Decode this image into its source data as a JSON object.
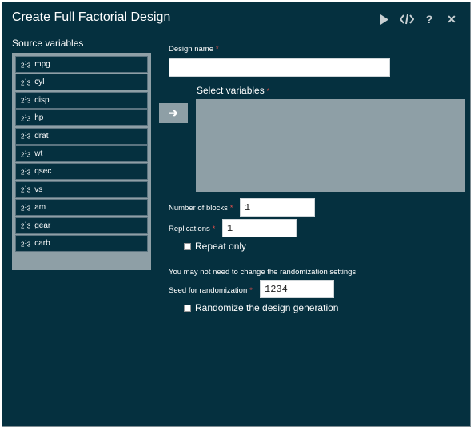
{
  "dialog": {
    "title": "Create Full Factorial Design",
    "icons": [
      "play-icon",
      "code-icon",
      "help-icon",
      "close-icon"
    ]
  },
  "source": {
    "label": "Source variables",
    "var_icon_text": "2",
    "var_icon_sup": "1",
    "var_icon_tail": "3",
    "items": [
      "mpg",
      "cyl",
      "disp",
      "hp",
      "drat",
      "wt",
      "qsec",
      "vs",
      "am",
      "gear",
      "carb"
    ]
  },
  "design_name": {
    "label": "Design name",
    "required": "*",
    "value": ""
  },
  "select_variables": {
    "label": "Select variables",
    "required": "*",
    "move_label": "➔"
  },
  "blocks": {
    "label": "Number of blocks",
    "required": "*",
    "value": "1"
  },
  "replications": {
    "label": "Replications",
    "required": "*",
    "value": "1"
  },
  "repeat_only": {
    "label": "Repeat only",
    "checked": false
  },
  "randomization_note": "You may not need to change the randomization settings",
  "seed": {
    "label": "Seed for randomization",
    "required": "*",
    "value": "1234"
  },
  "randomize": {
    "label": "Randomize the design generation",
    "checked": false
  },
  "colors": {
    "background": "#05303f",
    "panel": "#8e9fa6",
    "required": "#e9504c"
  }
}
